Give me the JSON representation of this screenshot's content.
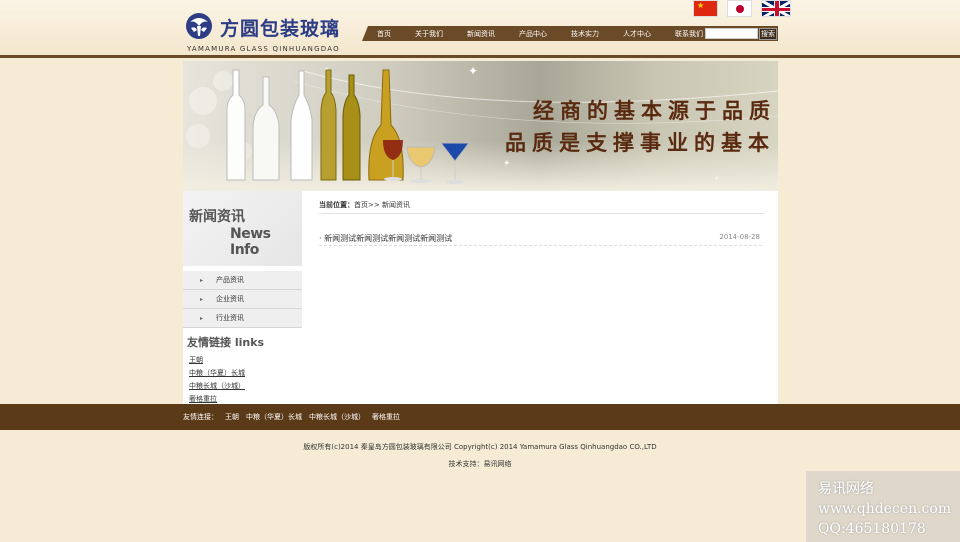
{
  "header": {
    "logo_cn": "方圆包装玻璃",
    "logo_en": "YAMAMURA GLASS QINHUANGDAO",
    "nav": [
      "首页",
      "关于我们",
      "新闻资讯",
      "产品中心",
      "技术实力",
      "人才中心",
      "联系我们"
    ],
    "search_placeholder": "",
    "search_button": "搜索",
    "colors": {
      "nav_bg": "#6b4a28",
      "logo_blue": "#2c3d86"
    }
  },
  "banner": {
    "line1": "经商的基本源于品质",
    "line2": "品质是支撑事业的基本"
  },
  "sidebar": {
    "title_cn": "新闻资讯",
    "title_en": "News Info",
    "items": [
      "产品资讯",
      "企业资讯",
      "行业资讯"
    ],
    "links_title": "友情链接  links",
    "links": [
      "王朝",
      "中粮（华夏）长城",
      "中粮长城（沙城）",
      "奢格重拉"
    ]
  },
  "main": {
    "breadcrumb_label": "当前位置：",
    "breadcrumb_path": "首页>> 新闻资讯",
    "news": [
      {
        "title": "新闻测试新闻测试新闻测试新闻测试",
        "date": "2014-08-28"
      }
    ]
  },
  "footer": {
    "links_label": "友情连接：",
    "links": [
      "王朝",
      "中粮（华夏）长城",
      "中粮长城（沙城）",
      "奢格重拉"
    ],
    "copyright": "版权所有(c)2014 秦皇岛方圆包装玻璃有限公司  Copyright(c) 2014 Yamamura Glass Qinhuangdao CO.,LTD",
    "support": "技术支持：易讯网络"
  },
  "watermark": {
    "line1": "易讯网络",
    "line2": "www.qhdecen.com",
    "line3": "QQ:465180178"
  }
}
